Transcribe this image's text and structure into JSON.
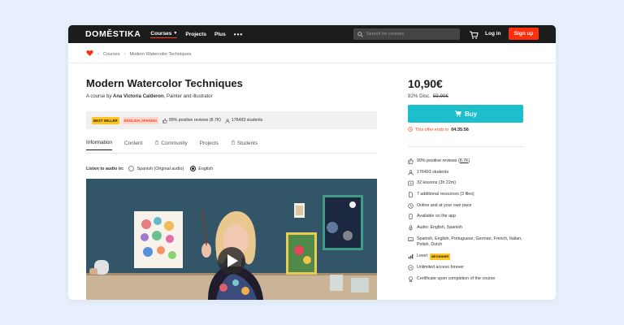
{
  "nav": {
    "logo": "DOMĚSTIKA",
    "links": [
      "Courses",
      "Projects",
      "Plus"
    ],
    "more": "•••",
    "search_placeholder": "Search for courses",
    "login": "Log in",
    "signup": "Sign up"
  },
  "breadcrumb": {
    "items": [
      "Courses",
      "Modern Watercolor Techniques"
    ]
  },
  "course": {
    "title": "Modern Watercolor Techniques",
    "byline_prefix": "A course by",
    "author": "Ana Victoria Calderon",
    "role": ", Painter and illustrator",
    "badge_bestseller": "BEST SELLER",
    "badge_lang": "ENGLISH, SPANISH",
    "reviews": "99% positive reviews (8.7K)",
    "students": "176493 students"
  },
  "tabs": [
    "Information",
    "Content",
    "Community",
    "Projects",
    "Students"
  ],
  "audio": {
    "label": "Listen to audio in:",
    "options": [
      "Spanish (Original audio)",
      "English"
    ],
    "selected": "English"
  },
  "purchase": {
    "price": "10,90€",
    "discount": "82% Disc.",
    "old_price": "59,90€",
    "buy_label": "Buy",
    "offer_text": "This offer ends in",
    "offer_time": "04:35:56"
  },
  "features": {
    "reviews_prefix": "99% positive reviews (",
    "reviews_link": "8.7K",
    "reviews_suffix": ")",
    "students": "176493 students",
    "lessons": "32 lessons (3h 22m)",
    "resources": "7 additional resources (3 files)",
    "online": "Online and at your own pace",
    "app": "Available on the app",
    "audio": "Audio: English, Spanish",
    "subtitles": "Spanish, English, Portuguese, German, French, Italian, Polish, Dutch",
    "level_label": "Level:",
    "level_value": "BEGINNER",
    "access": "Unlimited access forever",
    "certificate": "Certificate upon completion of the course"
  },
  "colors": {
    "accent": "#ff2f0e",
    "buy": "#1cbfcb",
    "badge_yellow": "#ffc41d"
  }
}
